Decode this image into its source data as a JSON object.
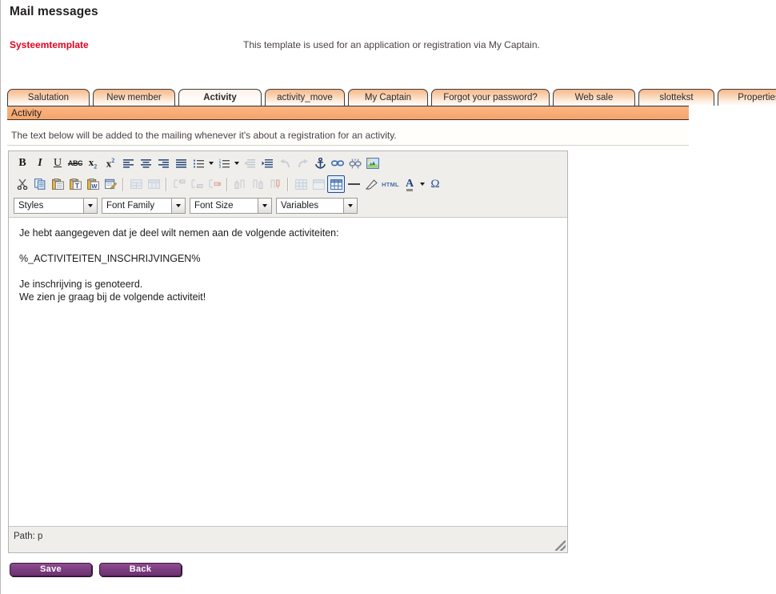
{
  "header": {
    "title": "Mail messages",
    "template_kind": "Systeemtemplate",
    "template_description": "This template is used for an application or registration via My Captain."
  },
  "tabs": [
    {
      "label": "Salutation",
      "active": false
    },
    {
      "label": "New member",
      "active": false
    },
    {
      "label": "Activity",
      "active": true
    },
    {
      "label": "activity_move",
      "active": false
    },
    {
      "label": "My Captain",
      "active": false
    },
    {
      "label": "Forgot your password?",
      "active": false
    },
    {
      "label": "Web sale",
      "active": false
    },
    {
      "label": "slottekst",
      "active": false
    },
    {
      "label": "Properties",
      "active": false
    }
  ],
  "section": {
    "title": "Activity",
    "instruction": "The text below will be added to the mailing whenever it's about a registration for an activity."
  },
  "editor": {
    "toolbar_row1": [
      {
        "name": "bold-icon",
        "label": "B"
      },
      {
        "name": "italic-icon",
        "label": "I"
      },
      {
        "name": "underline-icon",
        "label": "U"
      },
      {
        "name": "strikethrough-icon",
        "label": "ABC"
      },
      {
        "name": "subscript-icon",
        "label": "x"
      },
      {
        "name": "superscript-icon",
        "label": "x"
      },
      {
        "name": "align-left-icon",
        "label": ""
      },
      {
        "name": "align-center-icon",
        "label": ""
      },
      {
        "name": "align-right-icon",
        "label": ""
      },
      {
        "name": "align-justify-icon",
        "label": ""
      },
      {
        "name": "bullet-list-icon",
        "label": ""
      },
      {
        "name": "numbered-list-icon",
        "label": ""
      },
      {
        "name": "outdent-icon",
        "label": ""
      },
      {
        "name": "indent-icon",
        "label": ""
      },
      {
        "name": "undo-icon",
        "label": ""
      },
      {
        "name": "redo-icon",
        "label": ""
      },
      {
        "name": "anchor-icon",
        "label": ""
      },
      {
        "name": "insert-link-icon",
        "label": ""
      },
      {
        "name": "unlink-icon",
        "label": ""
      },
      {
        "name": "insert-image-icon",
        "label": ""
      }
    ],
    "toolbar_row2": [
      {
        "name": "cut-icon",
        "label": ""
      },
      {
        "name": "copy-icon",
        "label": ""
      },
      {
        "name": "paste-icon",
        "label": ""
      },
      {
        "name": "paste-as-text-icon",
        "label": ""
      },
      {
        "name": "paste-from-word-icon",
        "label": ""
      },
      {
        "name": "edit-source-icon",
        "label": ""
      },
      {
        "name": "merge-cells-icon",
        "label": ""
      },
      {
        "name": "split-cells-icon",
        "label": ""
      },
      {
        "name": "insert-row-before-icon",
        "label": ""
      },
      {
        "name": "insert-row-after-icon",
        "label": ""
      },
      {
        "name": "delete-row-icon",
        "label": ""
      },
      {
        "name": "insert-column-before-icon",
        "label": ""
      },
      {
        "name": "insert-column-after-icon",
        "label": ""
      },
      {
        "name": "delete-column-icon",
        "label": ""
      },
      {
        "name": "table-properties-icon",
        "label": ""
      },
      {
        "name": "row-properties-icon",
        "label": ""
      },
      {
        "name": "insert-table-icon",
        "label": ""
      },
      {
        "name": "horizontal-rule-icon",
        "label": ""
      },
      {
        "name": "remove-formatting-icon",
        "label": ""
      },
      {
        "name": "edit-html-icon",
        "label": "HTML"
      },
      {
        "name": "text-color-icon",
        "label": "A"
      },
      {
        "name": "special-character-icon",
        "label": "Ω"
      }
    ],
    "selects": [
      {
        "name": "styles-select",
        "value": "Styles"
      },
      {
        "name": "font-family-select",
        "value": "Font Family"
      },
      {
        "name": "font-size-select",
        "value": "Font Size"
      },
      {
        "name": "variables-select",
        "value": "Variables"
      }
    ],
    "content": {
      "p1": "Je hebt aangegeven dat je deel wilt nemen aan de volgende activiteiten:",
      "p2": "%_ACTIVITEITEN_INSCHRIJVINGEN%",
      "p3_line1": "Je inschrijving is genoteerd.",
      "p3_line2": "We zien je graag bij de volgende activiteit!"
    },
    "status_path": "Path: p"
  },
  "actions": {
    "save_label": "Save",
    "back_label": "Back"
  },
  "colors": {
    "accent_red": "#e8001e",
    "tab_orange": "#f6b98c",
    "section_orange": "#f9ad77",
    "button_purple": "#7c3f80"
  }
}
